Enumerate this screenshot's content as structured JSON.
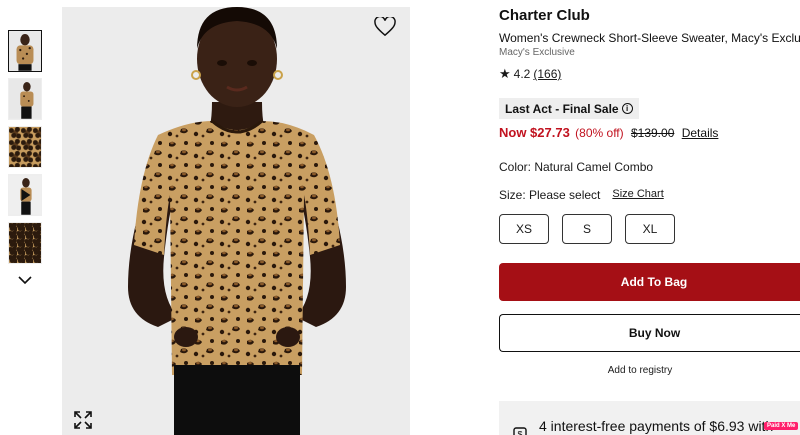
{
  "gallery": {
    "thumbnails": [
      {
        "name": "front-view"
      },
      {
        "name": "side-view"
      },
      {
        "name": "flat-lay"
      },
      {
        "name": "video"
      },
      {
        "name": "fabric-detail"
      }
    ],
    "icons": {
      "next": "chevron-down-icon",
      "favorite": "heart-icon",
      "zoom": "expand-icon",
      "play": "play-icon"
    }
  },
  "product": {
    "brand": "Charter Club",
    "title": "Women's Crewneck Short-Sleeve Sweater, Macy's Exclusive",
    "exclusive": "Macy's Exclusive",
    "rating": "4.2",
    "review_count": "(166)",
    "sale_badge": "Last Act - Final Sale",
    "price_now": "Now $27.73",
    "price_off": "(80% off)",
    "price_original": "$139.00",
    "price_details": "Details",
    "color_label": "Color: Natural Camel Combo",
    "size_label": "Size: Please select",
    "size_chart": "Size Chart",
    "sizes": [
      "XS",
      "S",
      "XL"
    ],
    "add_to_bag": "Add To Bag",
    "buy_now": "Buy Now",
    "registry": "Add to registry",
    "installments": "4 interest-free payments of $6.93 with",
    "pay_badge": "Paid X Me"
  },
  "colors": {
    "sale_red": "#c1121f",
    "bag_button": "#a50f15",
    "badge_bg": "#eeeeee"
  }
}
